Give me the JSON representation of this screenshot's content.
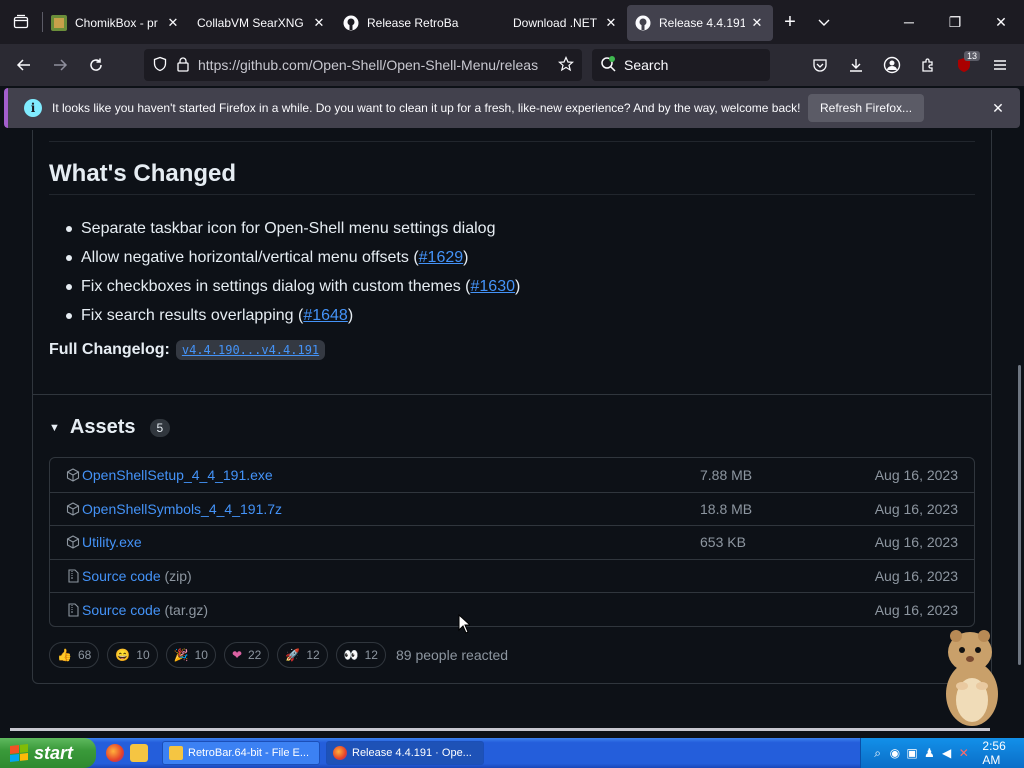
{
  "browser": {
    "tabs": [
      {
        "title": "ChomikBox - pr",
        "icon": "chomikbox-icon"
      },
      {
        "title": "CollabVM SearXNG",
        "icon": "searxng-icon"
      },
      {
        "title": "Release RetroBa",
        "icon": "github-icon"
      },
      {
        "title": "Download .NET",
        "icon": "dotnet-icon"
      },
      {
        "title": "Release 4.4.191",
        "icon": "github-icon",
        "active": true
      }
    ],
    "url": "https://github.com/Open-Shell/Open-Shell-Menu/releas",
    "search_placeholder": "Search",
    "extension_badge": "13"
  },
  "notification": {
    "message": "It looks like you haven't started Firefox in a while. Do you want to clean it up for a fresh, like-new experience? And by the way, welcome back!",
    "button": "Refresh Firefox..."
  },
  "release": {
    "whats_changed_title": "What's Changed",
    "changes": [
      {
        "text": "Separate taskbar icon for Open-Shell menu settings dialog",
        "pr": ""
      },
      {
        "text": "Allow negative horizontal/vertical menu offsets (",
        "pr": "#1629",
        "tail": ")"
      },
      {
        "text": "Fix checkboxes in settings dialog with custom themes (",
        "pr": "#1630",
        "tail": ")"
      },
      {
        "text": "Fix search results overlapping (",
        "pr": "#1648",
        "tail": ")"
      }
    ],
    "full_changelog_label": "Full Changelog:",
    "full_changelog_link": "v4.4.190...v4.4.191",
    "assets_title": "Assets",
    "assets_count": "5",
    "assets": [
      {
        "name": "OpenShellSetup_4_4_191.exe",
        "sub": "",
        "size": "7.88 MB",
        "date": "Aug 16, 2023",
        "icon": "package-icon"
      },
      {
        "name": "OpenShellSymbols_4_4_191.7z",
        "sub": "",
        "size": "18.8 MB",
        "date": "Aug 16, 2023",
        "icon": "package-icon"
      },
      {
        "name": "Utility.exe",
        "sub": "",
        "size": "653 KB",
        "date": "Aug 16, 2023",
        "icon": "package-icon"
      },
      {
        "name": "Source code",
        "sub": " (zip)",
        "size": "",
        "date": "Aug 16, 2023",
        "icon": "file-zip-icon"
      },
      {
        "name": "Source code",
        "sub": " (tar.gz)",
        "size": "",
        "date": "Aug 16, 2023",
        "icon": "file-zip-icon"
      }
    ],
    "reactions": [
      {
        "emoji": "👍",
        "count": "68",
        "icon": "thumbs-up-icon"
      },
      {
        "emoji": "😄",
        "count": "10",
        "icon": "laugh-icon"
      },
      {
        "emoji": "🎉",
        "count": "10",
        "icon": "hooray-icon"
      },
      {
        "emoji": "❤",
        "count": "22",
        "icon": "heart-icon"
      },
      {
        "emoji": "🚀",
        "count": "12",
        "icon": "rocket-icon"
      },
      {
        "emoji": "👀",
        "count": "12",
        "icon": "eyes-icon"
      }
    ],
    "people_reacted": "89 people reacted"
  },
  "taskbar": {
    "start_label": "start",
    "tasks": [
      {
        "title": "RetroBar.64-bit - File E...",
        "icon": "folder-icon"
      },
      {
        "title": "Release 4.4.191 · Ope...",
        "icon": "firefox-icon",
        "active": true
      }
    ],
    "clock": "2:56 AM"
  }
}
